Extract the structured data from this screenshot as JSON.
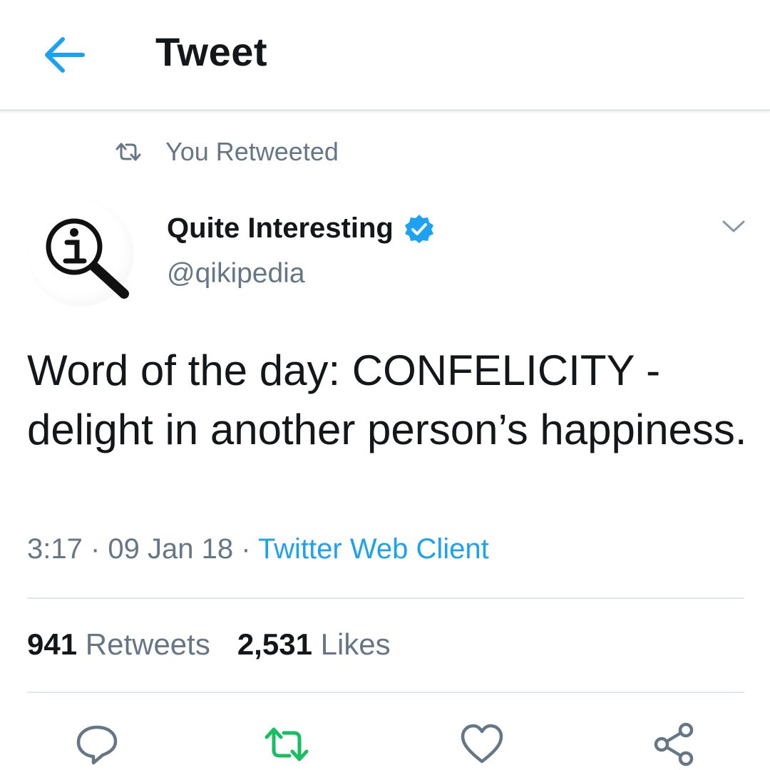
{
  "header": {
    "title": "Tweet",
    "back_icon": "arrow-left-icon"
  },
  "context": {
    "text": "You Retweeted",
    "icon": "retweet-icon"
  },
  "author": {
    "name": "Quite Interesting",
    "handle": "@qikipedia",
    "verified": true,
    "avatar_icon": "magnifier-info-logo"
  },
  "tweet": {
    "text": "Word of the day: CONFELICITY - delight in another person’s happiness.",
    "time": "3:17",
    "date": "09 Jan 18",
    "source": "Twitter Web Client",
    "separator": " · "
  },
  "stats": {
    "retweets": {
      "count": "941",
      "label": "Retweets"
    },
    "likes": {
      "count": "2,531",
      "label": "Likes"
    }
  },
  "actions": [
    "reply-icon",
    "retweet-icon",
    "like-icon",
    "share-icon"
  ],
  "colors": {
    "accent": "#1da1f2",
    "retweet_active": "#17bf63",
    "secondary_text": "#657786"
  }
}
